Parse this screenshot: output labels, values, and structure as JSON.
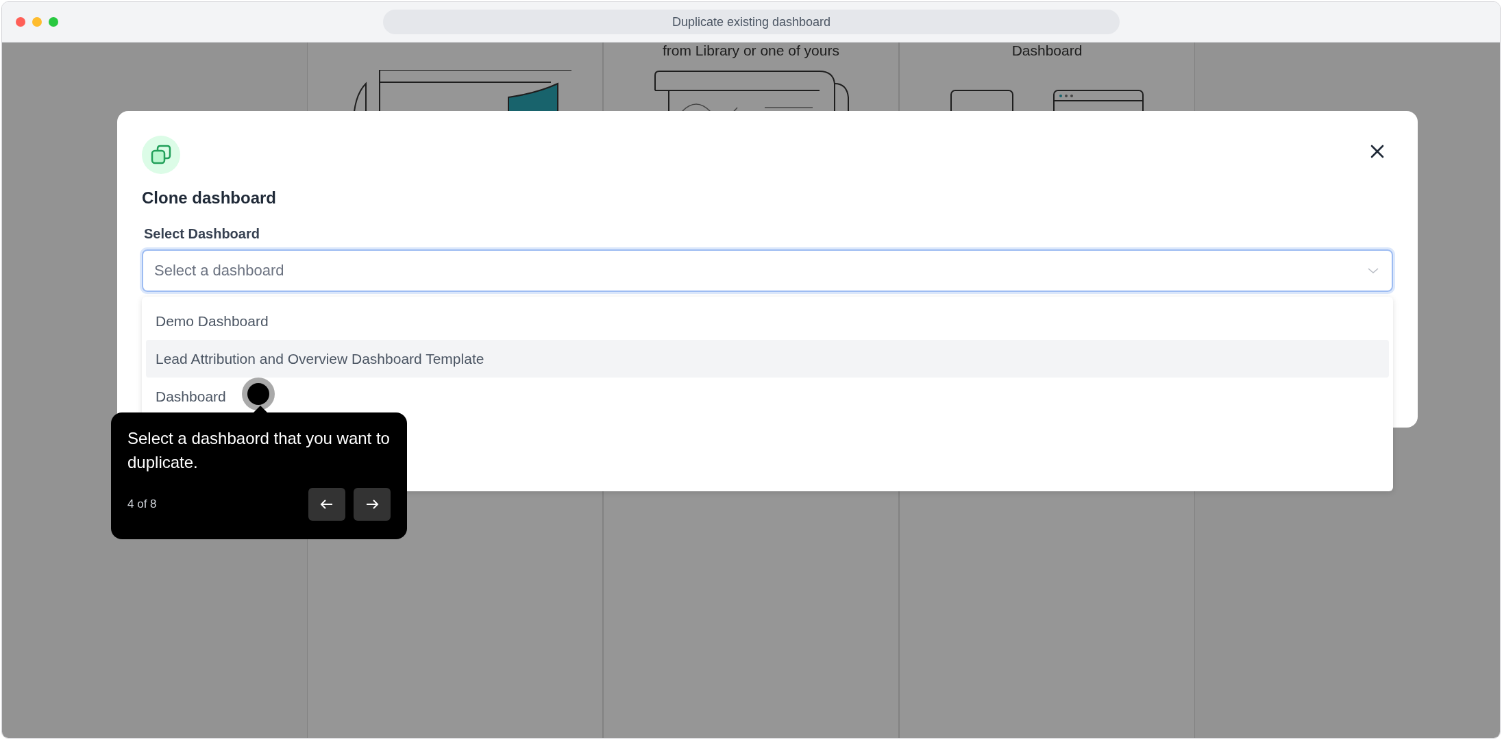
{
  "window": {
    "title": "Duplicate existing dashboard"
  },
  "background_cards": [
    {
      "kind": "board"
    },
    {
      "kind": "scroll",
      "caption": "from Library or one of yours"
    },
    {
      "kind": "widgets",
      "caption": "Dashboard"
    }
  ],
  "modal": {
    "title": "Clone dashboard",
    "field_label": "Select Dashboard",
    "select": {
      "placeholder": "Select a dashboard",
      "expanded": true
    },
    "options": [
      {
        "label": "Demo Dashboard",
        "highlighted": false
      },
      {
        "label": "Lead Attribution and Overview Dashboard Template",
        "highlighted": true
      },
      {
        "label": "Dashboard",
        "highlighted": false
      }
    ]
  },
  "tooltip": {
    "text": "Select a dashbaord that you want to duplicate.",
    "step": "4 of 8"
  }
}
